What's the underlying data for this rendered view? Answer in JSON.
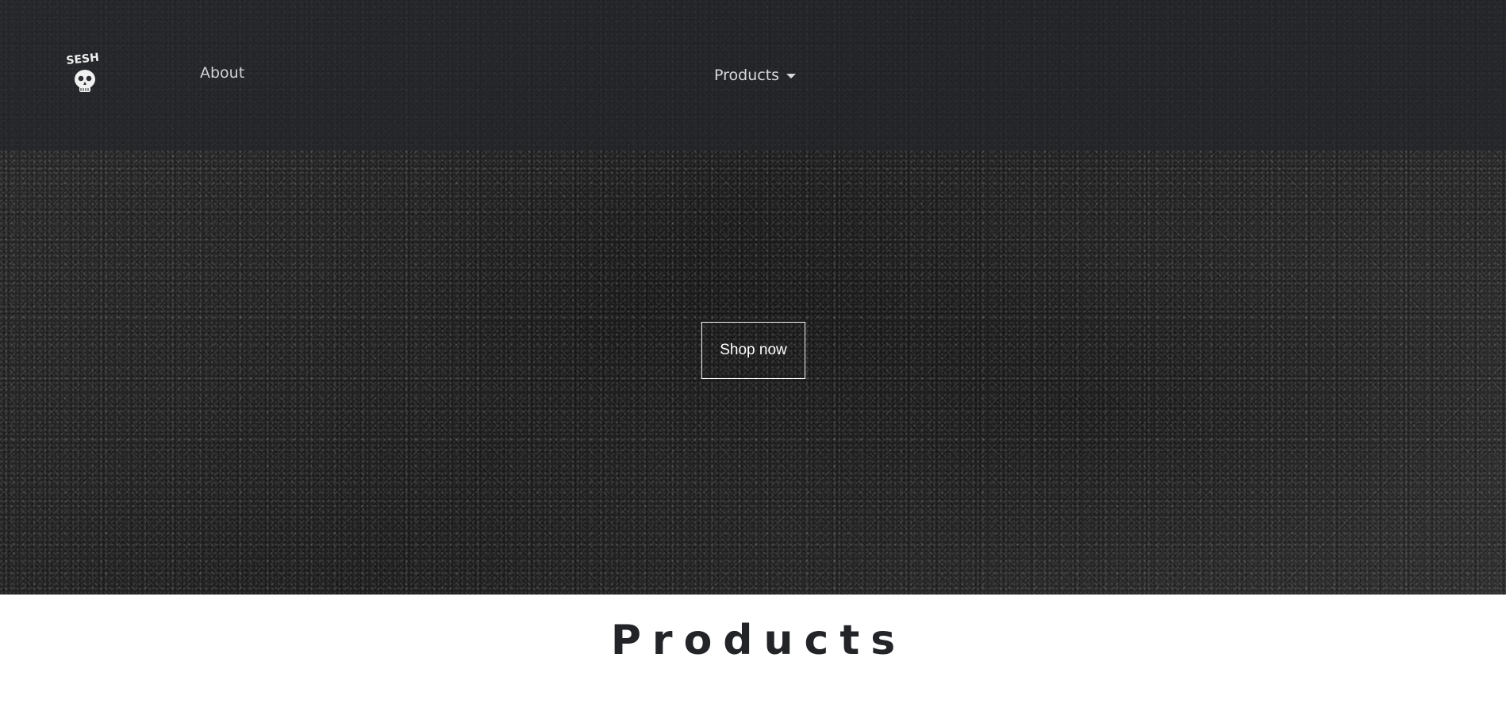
{
  "brand": {
    "logo_text": "SESH",
    "logo_icon": "skull-logo-icon"
  },
  "nav": {
    "about_label": "About",
    "products_label": "Products"
  },
  "hero": {
    "cta_label": "Shop now"
  },
  "section": {
    "title": "Products"
  },
  "colors": {
    "text_dark": "#222428",
    "nav_text": "#cfd2d6",
    "cta_border": "#f4f4f4",
    "hero_bg": "#262626"
  }
}
